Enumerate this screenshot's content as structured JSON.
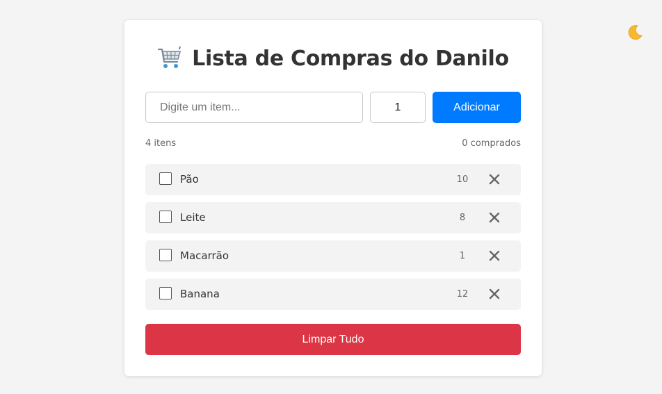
{
  "header": {
    "title": "Lista de Compras do Danilo",
    "icon": "shopping-cart-icon"
  },
  "theme_toggle": {
    "icon": "crescent-moon-icon",
    "color": "#f5b82e"
  },
  "form": {
    "item_placeholder": "Digite um item...",
    "item_value": "",
    "quantity_value": "1",
    "add_label": "Adicionar",
    "add_color": "#007bff"
  },
  "stats": {
    "total": "4 itens",
    "purchased": "0 comprados"
  },
  "items": [
    {
      "name": "Pão",
      "quantity": "10",
      "checked": false
    },
    {
      "name": "Leite",
      "quantity": "8",
      "checked": false
    },
    {
      "name": "Macarrão",
      "quantity": "1",
      "checked": false
    },
    {
      "name": "Banana",
      "quantity": "12",
      "checked": false
    }
  ],
  "clear_label": "Limpar Tudo",
  "clear_color": "#dc3545"
}
